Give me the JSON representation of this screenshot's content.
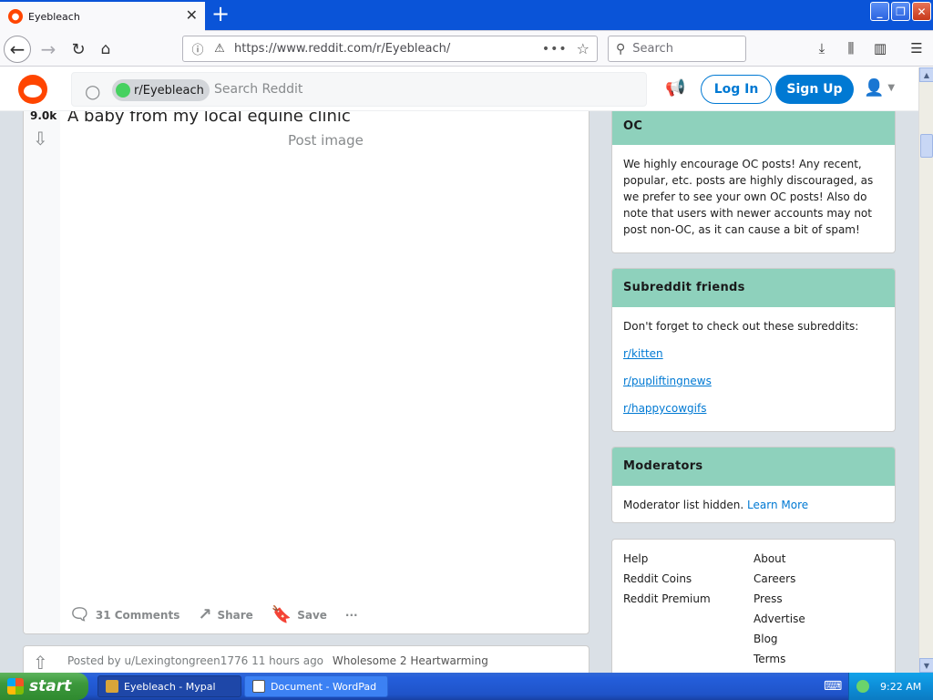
{
  "browser": {
    "tab_title": "Eyebleach",
    "tab_close": "✕",
    "new_tab": "+",
    "url": "https://www.reddit.com/r/Eyebleach/",
    "url_actions": "•••",
    "search_placeholder": "Search"
  },
  "reddit_header": {
    "subreddit_chip": "r/Eyebleach",
    "search_placeholder": "Search Reddit",
    "login_label": "Log In",
    "signup_label": "Sign Up"
  },
  "post": {
    "score": "9.0k",
    "title": "A baby from my local equine clinic",
    "image_placeholder": "Post image",
    "comments_label": "31 Comments",
    "share_label": "Share",
    "save_label": "Save",
    "more_label": "···"
  },
  "next_post": {
    "meta": "Posted by u/Lexingtongreen1776 11 hours ago",
    "flair": "Wholesome 2 Heartwarming"
  },
  "sidebar": {
    "oc": {
      "title": "OC",
      "body": "We highly encourage OC posts! Any recent, popular, etc. posts are highly discouraged, as we prefer to see your own OC posts! Also do note that users with newer accounts may not post non-OC, as it can cause a bit of spam!"
    },
    "friends": {
      "title": "Subreddit friends",
      "intro": "Don't forget to check out these subreddits:",
      "links": [
        "r/kitten",
        "r/pupliftingnews",
        "r/happycowgifs"
      ]
    },
    "moderators": {
      "title": "Moderators",
      "text": "Moderator list hidden.",
      "link": "Learn More"
    },
    "footer": {
      "col1": [
        "Help",
        "Reddit Coins",
        "Reddit Premium"
      ],
      "col2": [
        "About",
        "Careers",
        "Press",
        "Advertise",
        "Blog",
        "Terms"
      ]
    }
  },
  "taskbar": {
    "start_label": "start",
    "items": [
      "Eyebleach - Mypal",
      "Document - WordPad"
    ],
    "clock": "9:22 AM"
  },
  "colors": {
    "reddit_orange": "#ff4500",
    "reddit_blue": "#0079d3",
    "widget_header": "#8ed1bc",
    "page_bg": "#dae0e6",
    "xp_taskbar": "#245edb",
    "xp_start": "#3c983c"
  }
}
